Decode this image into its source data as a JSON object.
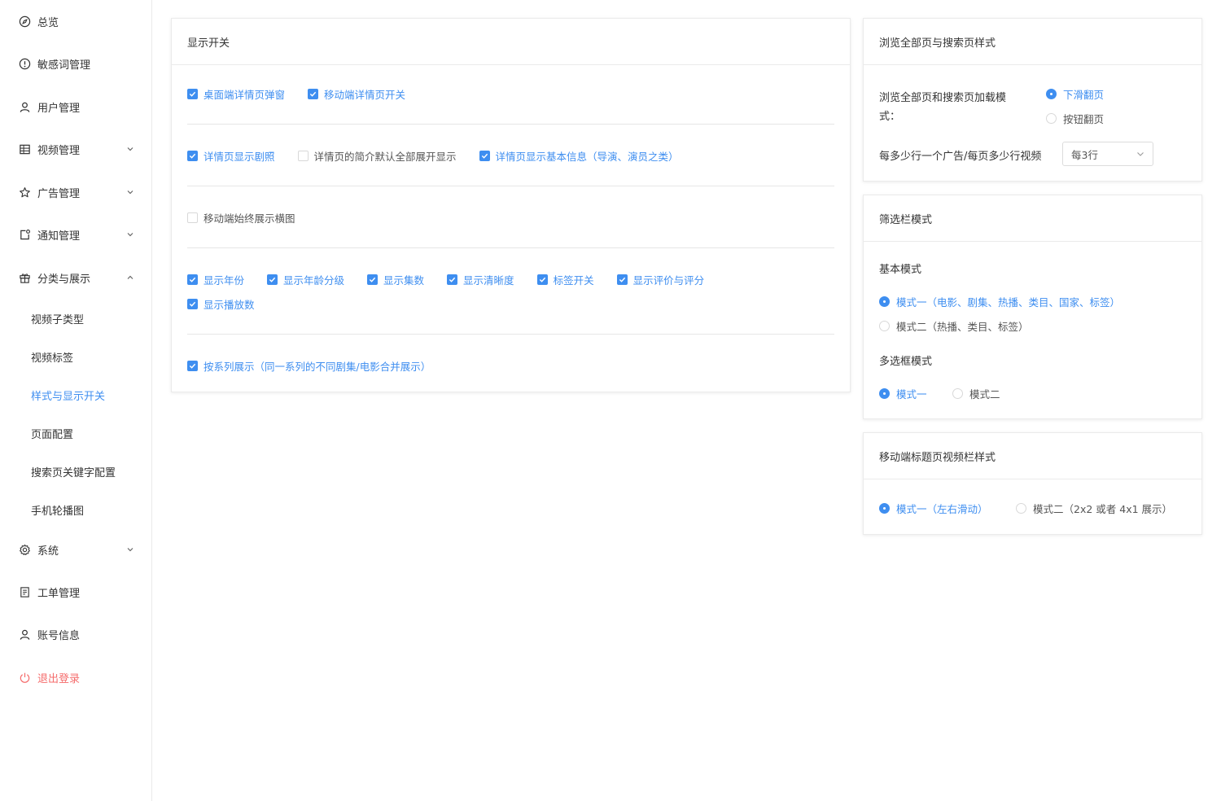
{
  "sidebar": {
    "items": [
      {
        "label": "总览",
        "icon": "compass-icon"
      },
      {
        "label": "敏感词管理",
        "icon": "alert-circle-icon"
      },
      {
        "label": "用户管理",
        "icon": "user-icon"
      },
      {
        "label": "视频管理",
        "icon": "grid-icon"
      },
      {
        "label": "广告管理",
        "icon": "star-icon"
      },
      {
        "label": "通知管理",
        "icon": "notification-icon"
      },
      {
        "label": "分类与展示",
        "icon": "gift-icon"
      },
      {
        "label": "系统",
        "icon": "gear-icon"
      },
      {
        "label": "工单管理",
        "icon": "document-icon"
      },
      {
        "label": "账号信息",
        "icon": "user-icon"
      },
      {
        "label": "退出登录",
        "icon": "power-icon"
      }
    ],
    "subitems": [
      {
        "label": "视频子类型"
      },
      {
        "label": "视频标签"
      },
      {
        "label": "样式与显示开关"
      },
      {
        "label": "页面配置"
      },
      {
        "label": "搜索页关键字配置"
      },
      {
        "label": "手机轮播图"
      }
    ]
  },
  "display_switch": {
    "title": "显示开关",
    "group1": [
      {
        "label": "桌面端详情页弹窗",
        "checked": true
      },
      {
        "label": "移动端详情页开关",
        "checked": true
      }
    ],
    "group2": [
      {
        "label": "详情页显示剧照",
        "checked": true
      },
      {
        "label": "详情页的简介默认全部展开显示",
        "checked": false
      },
      {
        "label": "详情页显示基本信息（导演、演员之类）",
        "checked": true
      }
    ],
    "group3": [
      {
        "label": "移动端始终展示横图",
        "checked": false
      }
    ],
    "group4": [
      {
        "label": "显示年份",
        "checked": true
      },
      {
        "label": "显示年龄分级",
        "checked": true
      },
      {
        "label": "显示集数",
        "checked": true
      },
      {
        "label": "显示清晰度",
        "checked": true
      },
      {
        "label": "标签开关",
        "checked": true
      },
      {
        "label": "显示评价与评分",
        "checked": true
      },
      {
        "label": "显示播放数",
        "checked": true
      }
    ],
    "group5": [
      {
        "label": "按系列展示（同一系列的不同剧集/电影合并展示）",
        "checked": true
      }
    ]
  },
  "browse_style": {
    "title": "浏览全部页与搜索页样式",
    "load_label_line1": "浏览全部页和搜索页加载模",
    "load_label_line2": "式：",
    "load_options": [
      {
        "label": "下滑翻页",
        "selected": true
      },
      {
        "label": "按钮翻页",
        "selected": false
      }
    ],
    "ad_label": "每多少行一个广告/每页多少行视频",
    "ad_select_value": "每3行"
  },
  "filter_style": {
    "title": "筛选栏模式",
    "basic_label": "基本模式",
    "basic_options": [
      {
        "label": "模式一（电影、剧集、热播、类目、国家、标签）",
        "selected": true
      },
      {
        "label": "模式二（热播、类目、标签）",
        "selected": false
      }
    ],
    "multi_label": "多选框模式",
    "multi_options": [
      {
        "label": "模式一",
        "selected": true
      },
      {
        "label": "模式二",
        "selected": false
      }
    ]
  },
  "mobile_title_style": {
    "title": "移动端标题页视频栏样式",
    "options": [
      {
        "label": "模式一（左右滑动）",
        "selected": true
      },
      {
        "label": "模式二（2x2 或者 4x1 展示）",
        "selected": false
      }
    ]
  },
  "colors": {
    "accent": "#3e8ef0",
    "danger": "#f56c6c",
    "border": "#ebebeb"
  }
}
